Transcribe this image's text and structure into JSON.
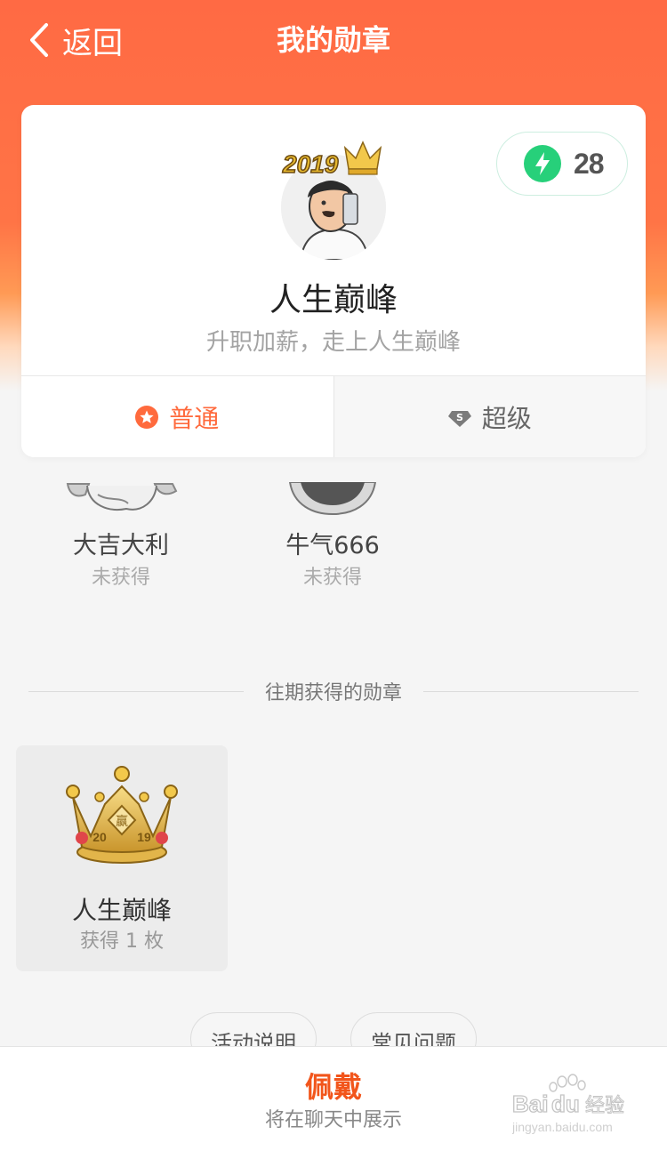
{
  "nav": {
    "back_label": "返回",
    "title": "我的勋章"
  },
  "current_badge": {
    "avatar_year_text": "2019",
    "energy_count": "28",
    "title": "人生巅峰",
    "description": "升职加薪，走上人生巅峰"
  },
  "tabs": [
    {
      "label": "普通",
      "icon": "star-circle-icon",
      "active": true
    },
    {
      "label": "超级",
      "icon": "diamond-s-icon",
      "active": false
    }
  ],
  "medals": [
    {
      "name": "大吉大利",
      "status": "未获得"
    },
    {
      "name": "牛气666",
      "status": "未获得"
    }
  ],
  "past_section": {
    "heading": "往期获得的勋章",
    "items": [
      {
        "name": "人生巅峰",
        "count": "获得 1 枚",
        "crown_text": "赢",
        "crown_year_left": "20",
        "crown_year_right": "19"
      }
    ]
  },
  "links": {
    "activity": "活动说明",
    "faq": "常见问题"
  },
  "footer": {
    "title": "佩戴",
    "subtitle": "将在聊天中展示"
  },
  "watermark": {
    "brand": "Bai",
    "brand2": "du",
    "brand_cn": "经验",
    "url": "jingyan.baidu.com"
  },
  "colors": {
    "header": "#ff6a44",
    "accent": "#ff6a3d",
    "energy": "#27d07a",
    "footer_title": "#f2551b"
  }
}
